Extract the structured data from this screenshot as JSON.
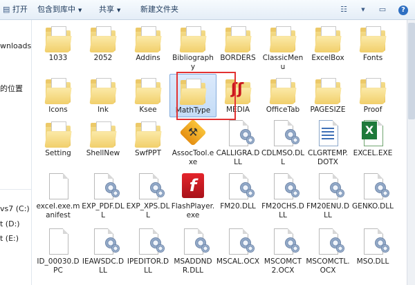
{
  "toolbar": {
    "open": "打开",
    "include": "包含到库中",
    "share": "共享",
    "new_folder": "新建文件夹"
  },
  "sidebar": {
    "items": [
      "wnloads",
      "的位置",
      "vs7 (C:)",
      "t (D:)",
      "t (E:)"
    ]
  },
  "files": [
    {
      "label": "1033",
      "type": "folder"
    },
    {
      "label": "2052",
      "type": "folder"
    },
    {
      "label": "Addins",
      "type": "folder"
    },
    {
      "label": "Bibliography",
      "type": "folder"
    },
    {
      "label": "BORDERS",
      "type": "folder"
    },
    {
      "label": "ClassicMenu",
      "type": "folder"
    },
    {
      "label": "ExcelBox",
      "type": "folder"
    },
    {
      "label": "Fonts",
      "type": "folder"
    },
    {
      "label": "Icons",
      "type": "folder"
    },
    {
      "label": "Ink",
      "type": "folder"
    },
    {
      "label": "Ksee",
      "type": "folder"
    },
    {
      "label": "MathType",
      "type": "folder",
      "selected": true
    },
    {
      "label": "MEDIA",
      "type": "media"
    },
    {
      "label": "OfficeTab",
      "type": "folder"
    },
    {
      "label": "PAGESIZE",
      "type": "folder"
    },
    {
      "label": "Proof",
      "type": "folder"
    },
    {
      "label": "Setting",
      "type": "folder"
    },
    {
      "label": "ShellNew",
      "type": "folder"
    },
    {
      "label": "SwfPPT",
      "type": "folder"
    },
    {
      "label": "AssocTool.exe",
      "type": "tool"
    },
    {
      "label": "CALLIGRA.DLL",
      "type": "dll"
    },
    {
      "label": "CDLMSO.DLL",
      "type": "dll"
    },
    {
      "label": "CLGRTEMP.DOTX",
      "type": "dotx"
    },
    {
      "label": "EXCEL.EXE",
      "type": "excel"
    },
    {
      "label": "excel.exe.manifest",
      "type": "doc"
    },
    {
      "label": "EXP_PDF.DLL",
      "type": "dll"
    },
    {
      "label": "EXP_XPS.DLL",
      "type": "dll"
    },
    {
      "label": "FlashPlayer.exe",
      "type": "flash"
    },
    {
      "label": "FM20.DLL",
      "type": "dll"
    },
    {
      "label": "FM20CHS.DLL",
      "type": "dll"
    },
    {
      "label": "FM20ENU.DLL",
      "type": "dll"
    },
    {
      "label": "GENKO.DLL",
      "type": "dll"
    },
    {
      "label": "ID_00030.DPC",
      "type": "doc"
    },
    {
      "label": "IEAWSDC.DLL",
      "type": "dll"
    },
    {
      "label": "IPEDITOR.DLL",
      "type": "dll"
    },
    {
      "label": "MSADDNDR.DLL",
      "type": "dll"
    },
    {
      "label": "MSCAL.OCX",
      "type": "dll"
    },
    {
      "label": "MSCOMCT2.OCX",
      "type": "dll"
    },
    {
      "label": "MSCOMCTL.OCX",
      "type": "dll"
    },
    {
      "label": "MSO.DLL",
      "type": "dll"
    }
  ]
}
